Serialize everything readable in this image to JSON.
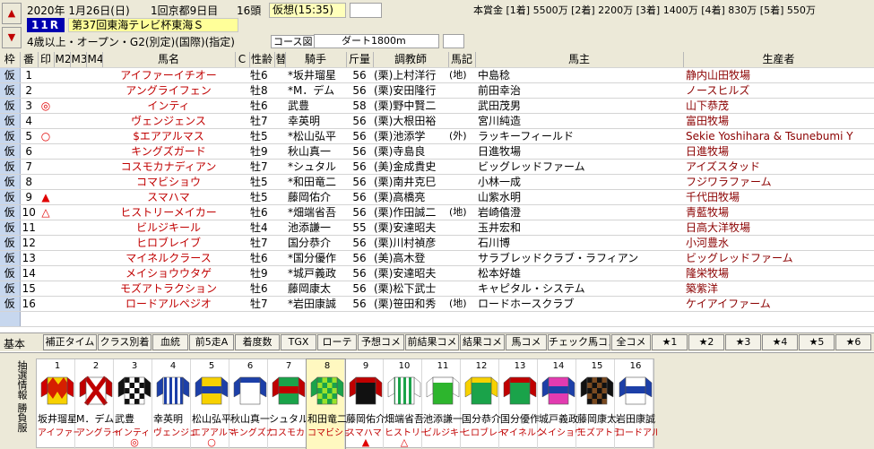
{
  "header": {
    "date": "2020年 1月26日(日)",
    "meeting": "1回京都9日目",
    "field_size": "16頭",
    "forecast": "仮想(15:35)",
    "race_number": "11R",
    "race_name": "第37回東海テレビ杯東海Ｓ",
    "conditions": "4歳以上・オープン・G2(別定)(国際)(指定)",
    "course_label": "コース図",
    "distance": "ダート1800m",
    "prize": "本賞金 [1着] 5500万 [2着] 2200万 [3着] 1400万 [4着] 830万 [5着] 550万",
    "nav_up": "▲",
    "nav_down": "▼"
  },
  "columns": {
    "frame": "枠",
    "num": "番",
    "mark": "印",
    "m2": "M2",
    "m3": "M3",
    "m4": "M4",
    "horse": "馬名",
    "c": "C",
    "sex_age": "性齢",
    "flag": "替",
    "jockey": "騎手",
    "weight": "斤量",
    "trainer": "調教師",
    "badge": "馬記",
    "owner": "馬主",
    "breeder": "生産者"
  },
  "entries": [
    {
      "frame": "仮",
      "num": "1",
      "mark": "",
      "horse": "アイファーイチオー",
      "sex_age": "牡6",
      "jockey": "*坂井瑠星",
      "weight": "56",
      "trainer": "(栗)上村洋行",
      "badge": "(地)",
      "owner": "中島稔",
      "breeder": "静内山田牧場"
    },
    {
      "frame": "仮",
      "num": "2",
      "mark": "",
      "horse": "アングライフェン",
      "sex_age": "牡8",
      "jockey": "*M．デム",
      "weight": "56",
      "trainer": "(栗)安田隆行",
      "badge": "",
      "owner": "前田幸治",
      "breeder": "ノースヒルズ"
    },
    {
      "frame": "仮",
      "num": "3",
      "mark": "◎",
      "horse": "インティ",
      "sex_age": "牡6",
      "jockey": "武豊",
      "weight": "58",
      "trainer": "(栗)野中賢二",
      "badge": "",
      "owner": "武田茂男",
      "breeder": "山下恭茂"
    },
    {
      "frame": "仮",
      "num": "4",
      "mark": "",
      "horse": "ヴェンジェンス",
      "sex_age": "牡7",
      "jockey": "幸英明",
      "weight": "56",
      "trainer": "(栗)大根田裕",
      "badge": "",
      "owner": "宮川純造",
      "breeder": "富田牧場"
    },
    {
      "frame": "仮",
      "num": "5",
      "mark": "○",
      "horse": "$エアアルマス",
      "sex_age": "牡5",
      "jockey": "*松山弘平",
      "weight": "56",
      "trainer": "(栗)池添学",
      "badge": "(外)",
      "owner": "ラッキーフィールド",
      "breeder": "Sekie Yoshihara & Tsunebumi Y"
    },
    {
      "frame": "仮",
      "num": "6",
      "mark": "",
      "horse": "キングズガード",
      "sex_age": "牡9",
      "jockey": "秋山真一",
      "weight": "56",
      "trainer": "(栗)寺島良",
      "badge": "",
      "owner": "日進牧場",
      "breeder": "日進牧場"
    },
    {
      "frame": "仮",
      "num": "7",
      "mark": "",
      "horse": "コスモカナディアン",
      "sex_age": "牡7",
      "jockey": "*シュタル",
      "weight": "56",
      "trainer": "(美)金成貴史",
      "badge": "",
      "owner": "ビッグレッドファーム",
      "breeder": "アイズスタッド"
    },
    {
      "frame": "仮",
      "num": "8",
      "mark": "",
      "horse": "コマビショウ",
      "sex_age": "牡5",
      "jockey": "*和田竜二",
      "weight": "56",
      "trainer": "(栗)南井克巳",
      "badge": "",
      "owner": "小林一成",
      "breeder": "フジワラファーム"
    },
    {
      "frame": "仮",
      "num": "9",
      "mark": "▲",
      "horse": "スマハマ",
      "sex_age": "牡5",
      "jockey": "藤岡佑介",
      "weight": "56",
      "trainer": "(栗)高橋亮",
      "badge": "",
      "owner": "山紫水明",
      "breeder": "千代田牧場"
    },
    {
      "frame": "仮",
      "num": "10",
      "mark": "△",
      "horse": "ヒストリーメイカー",
      "sex_age": "牡6",
      "jockey": "*畑端省吾",
      "weight": "56",
      "trainer": "(栗)作田誠二",
      "badge": "(地)",
      "owner": "岩崎僖澄",
      "breeder": "青藍牧場"
    },
    {
      "frame": "仮",
      "num": "11",
      "mark": "",
      "horse": "ビルジキール",
      "sex_age": "牡4",
      "jockey": "池添謙一",
      "weight": "55",
      "trainer": "(栗)安達昭夫",
      "badge": "",
      "owner": "玉井宏和",
      "breeder": "日高大洋牧場"
    },
    {
      "frame": "仮",
      "num": "12",
      "mark": "",
      "horse": "ヒロブレイブ",
      "sex_age": "牡7",
      "jockey": "国分恭介",
      "weight": "56",
      "trainer": "(栗)川村禎彦",
      "badge": "",
      "owner": "石川博",
      "breeder": "小河豊水"
    },
    {
      "frame": "仮",
      "num": "13",
      "mark": "",
      "horse": "マイネルクラース",
      "sex_age": "牡6",
      "jockey": "*国分優作",
      "weight": "56",
      "trainer": "(美)高木登",
      "badge": "",
      "owner": "サラブレッドクラブ・ラフィアン",
      "breeder": "ビッグレッドファーム"
    },
    {
      "frame": "仮",
      "num": "14",
      "mark": "",
      "horse": "メイショウウタゲ",
      "sex_age": "牡9",
      "jockey": "*城戸義政",
      "weight": "56",
      "trainer": "(栗)安達昭夫",
      "badge": "",
      "owner": "松本好雄",
      "breeder": "隆栄牧場"
    },
    {
      "frame": "仮",
      "num": "15",
      "mark": "",
      "horse": "モズアトラクション",
      "sex_age": "牡6",
      "jockey": "藤岡康太",
      "weight": "56",
      "trainer": "(栗)松下武士",
      "badge": "",
      "owner": "キャピタル・システム",
      "breeder": "築紫洋"
    },
    {
      "frame": "仮",
      "num": "16",
      "mark": "",
      "horse": "ロードアルペジオ",
      "sex_age": "牡7",
      "jockey": "*岩田康誠",
      "weight": "56",
      "trainer": "(栗)笹田和秀",
      "badge": "(地)",
      "owner": "ロードホースクラブ",
      "breeder": "ケイアイファーム"
    }
  ],
  "toolbar": {
    "label": "基本",
    "buttons": [
      "補正タイム",
      "クラス別着",
      "血統",
      "前5走A",
      "着度数",
      "TGX",
      "ローテ",
      "予想コメ",
      "前結果コメ",
      "結果コメ",
      "馬コメ",
      "チェック馬コメ",
      "全コメ",
      "★1",
      "★2",
      "★3",
      "★4",
      "★5",
      "★6"
    ]
  },
  "bottom": {
    "label": "抽選情報 勝負服",
    "silks": [
      {
        "num": "1",
        "jockey": "坂井瑠星",
        "horse": "アイファーイチ",
        "mark": "",
        "colors": [
          "#f7d100",
          "#d00000"
        ],
        "pattern": "diamond"
      },
      {
        "num": "2",
        "jockey": "M．デム",
        "horse": "アングライフェ",
        "mark": "",
        "colors": [
          "#ffffff",
          "#c00000"
        ],
        "pattern": "cross"
      },
      {
        "num": "3",
        "jockey": "武豊",
        "horse": "インティ",
        "mark": "◎",
        "colors": [
          "#ffffff",
          "#111111"
        ],
        "pattern": "check"
      },
      {
        "num": "4",
        "jockey": "幸英明",
        "horse": "ヴェンジェンス",
        "mark": "",
        "colors": [
          "#ffffff",
          "#1c3fa8"
        ],
        "pattern": "stripe"
      },
      {
        "num": "5",
        "jockey": "松山弘平",
        "horse": "エアアルマス",
        "mark": "○",
        "colors": [
          "#f7d100",
          "#1c3fa8"
        ],
        "pattern": "band"
      },
      {
        "num": "6",
        "jockey": "秋山真一",
        "horse": "キングズガード",
        "mark": "",
        "colors": [
          "#ffffff",
          "#1c3fa8"
        ],
        "pattern": "plain"
      },
      {
        "num": "7",
        "jockey": "シュタル",
        "horse": "コスモカナディ",
        "mark": "",
        "colors": [
          "#1aa34a",
          "#c00000"
        ],
        "pattern": "band"
      },
      {
        "num": "8",
        "jockey": "和田竜二",
        "horse": "コマビショウ",
        "mark": "",
        "colors": [
          "#9be22b",
          "#1aa34a"
        ],
        "pattern": "check"
      },
      {
        "num": "9",
        "jockey": "藤岡佑介",
        "horse": "スマハマ",
        "mark": "▲",
        "colors": [
          "#111111",
          "#c00000"
        ],
        "pattern": "plain"
      },
      {
        "num": "10",
        "jockey": "畑端省吾",
        "horse": "ヒストリーメイ",
        "mark": "△",
        "colors": [
          "#1aa34a",
          "#ffffff"
        ],
        "pattern": "stripe"
      },
      {
        "num": "11",
        "jockey": "池添謙一",
        "horse": "ビルジキール",
        "mark": "",
        "colors": [
          "#2db52d",
          "#ffffff"
        ],
        "pattern": "plain"
      },
      {
        "num": "12",
        "jockey": "国分恭介",
        "horse": "ヒロブレイブ",
        "mark": "",
        "colors": [
          "#1aa34a",
          "#f7d100"
        ],
        "pattern": "plain"
      },
      {
        "num": "13",
        "jockey": "国分優作",
        "horse": "マイネルクラー",
        "mark": "",
        "colors": [
          "#1aa34a",
          "#c00000"
        ],
        "pattern": "plain"
      },
      {
        "num": "14",
        "jockey": "城戸義政",
        "horse": "メイショウウタ",
        "mark": "",
        "colors": [
          "#e23bb0",
          "#1c3fa8"
        ],
        "pattern": "band"
      },
      {
        "num": "15",
        "jockey": "藤岡康太",
        "horse": "モズアトラク",
        "mark": "",
        "colors": [
          "#7a4a20",
          "#111111"
        ],
        "pattern": "check"
      },
      {
        "num": "16",
        "jockey": "岩田康誠",
        "horse": "ロードアルペジ",
        "mark": "",
        "colors": [
          "#ffffff",
          "#1c3fa8"
        ],
        "pattern": "band"
      }
    ]
  }
}
